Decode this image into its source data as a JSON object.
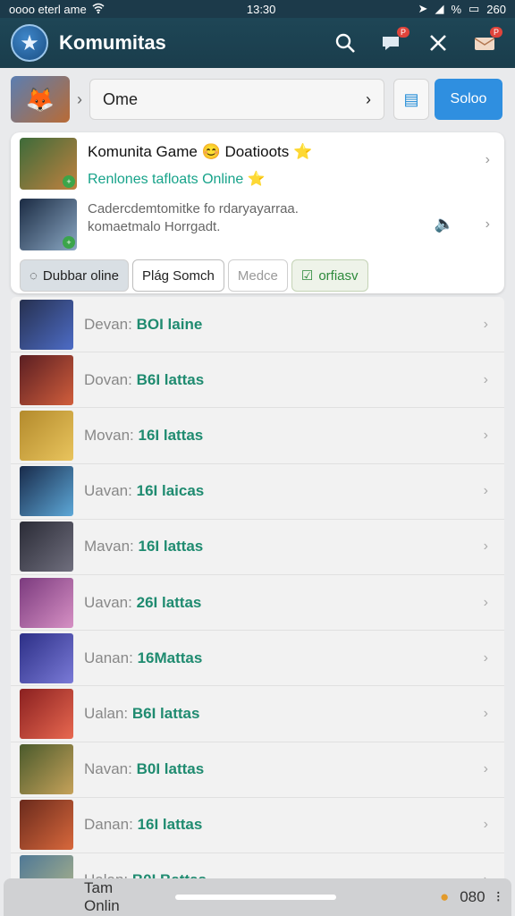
{
  "status": {
    "carrier": "oooo eterl ame",
    "time": "13:30",
    "right": "%",
    "battery": "260"
  },
  "header": {
    "title": "Komumitas",
    "badge_notif": "P",
    "badge_mail": "P"
  },
  "search": {
    "value": "Ome",
    "action_label": "Soloo"
  },
  "featured": {
    "title": "Komunita Game 😊 Doatioots ⭐",
    "subtitle": "Renlones tafloats Online ⭐",
    "description": "Cadercdemtomitke fo rdaryayarraa. komaetmalo Horrgadt.",
    "chips": [
      "Dubbar oline",
      "Plág Somch",
      "Medce",
      "orfiasv"
    ]
  },
  "list": {
    "rows": [
      {
        "label": "Devan:",
        "value": "BOI laine",
        "colors": [
          "#26304f",
          "#4d6cc6"
        ]
      },
      {
        "label": "Dovan:",
        "value": "B6I lattas",
        "colors": [
          "#5a1e22",
          "#d15e3c"
        ]
      },
      {
        "label": "Movan:",
        "value": "16I lattas",
        "colors": [
          "#b38a2c",
          "#e9c45d"
        ]
      },
      {
        "label": "Uavan:",
        "value": "16I laicas",
        "colors": [
          "#182a4a",
          "#5da8d8"
        ]
      },
      {
        "label": "Mavan:",
        "value": "16I lattas",
        "colors": [
          "#2a2b36",
          "#706f7e"
        ]
      },
      {
        "label": "Uavan:",
        "value": "26I lattas",
        "colors": [
          "#7b3a7e",
          "#d690c4"
        ]
      },
      {
        "label": "Uanan:",
        "value": "16Mattas",
        "colors": [
          "#2c2f86",
          "#7a7ad7"
        ]
      },
      {
        "label": "Ualan:",
        "value": "B6I lattas",
        "colors": [
          "#8a2020",
          "#e86850"
        ]
      },
      {
        "label": "Navan:",
        "value": "B0I lattas",
        "colors": [
          "#4a5a2c",
          "#c6a25a"
        ]
      },
      {
        "label": "Danan:",
        "value": "16I lattas",
        "colors": [
          "#6a2a1c",
          "#d8683c"
        ]
      },
      {
        "label": "Ualan:",
        "value": "B0I Battas",
        "colors": [
          "#4f7896",
          "#b1b78a"
        ]
      }
    ]
  },
  "bottom": {
    "left": "Tam Onlin",
    "right_count": "080"
  }
}
